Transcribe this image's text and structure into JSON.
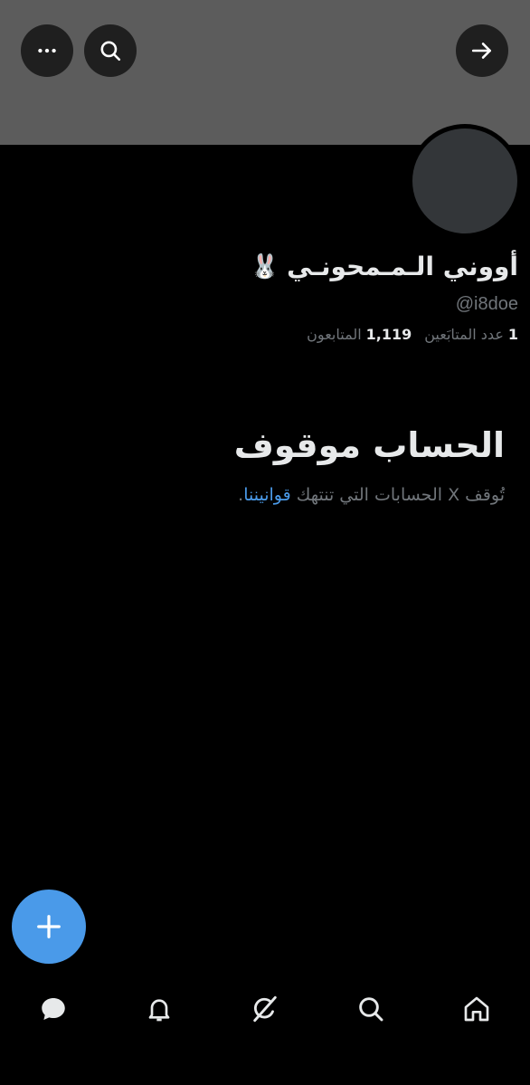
{
  "header": {
    "more_icon": "ellipsis-icon",
    "search_icon": "search-icon",
    "forward_icon": "arrow-right-icon",
    "banner_color": "#5c5c5c"
  },
  "profile": {
    "display_name": "أووني الـمـمحونـي",
    "name_emoji": "🐰",
    "handle": "@i8doe",
    "following_count": "1",
    "following_label": "عدد المتابَعين",
    "followers_count": "1,119",
    "followers_label": "المتابعون"
  },
  "suspended": {
    "title": "الحساب موقوف",
    "description_prefix": "تُوقف X الحسابات التي تنتهك",
    "rules_link": "قوانيننا",
    "description_suffix": "."
  },
  "fab": {
    "icon": "plus-icon",
    "color": "#4a9ae9"
  },
  "bottom_nav": {
    "items": [
      {
        "icon": "messages-icon"
      },
      {
        "icon": "bell-icon"
      },
      {
        "icon": "grok-icon"
      },
      {
        "icon": "search-icon"
      },
      {
        "icon": "home-icon"
      }
    ]
  }
}
